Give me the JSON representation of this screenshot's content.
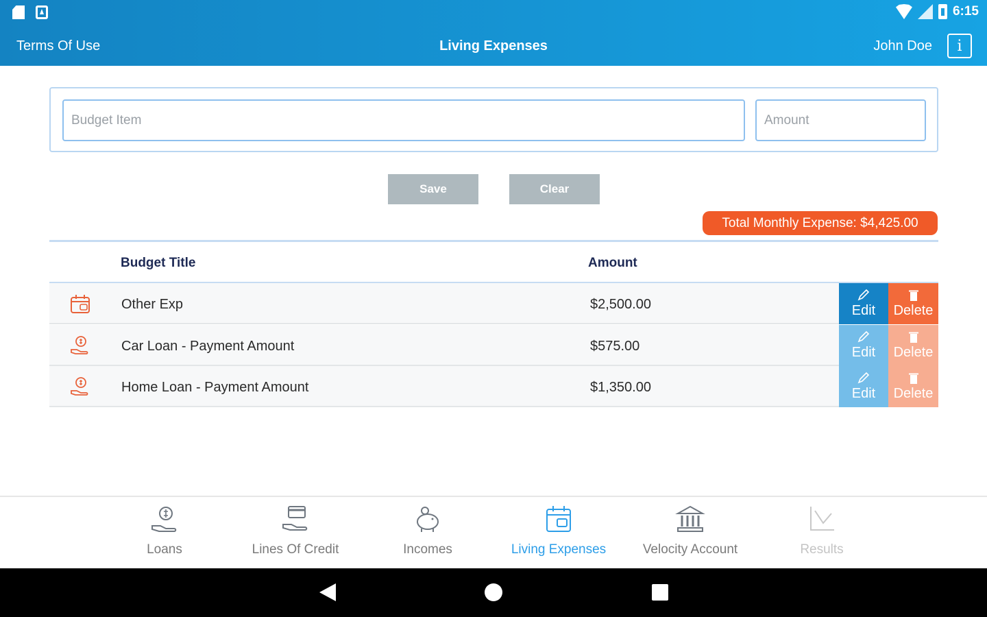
{
  "status_bar": {
    "time": "6:15"
  },
  "header": {
    "terms_label": "Terms Of Use",
    "title": "Living Expenses",
    "user_name": "John Doe",
    "info_label": "i"
  },
  "form": {
    "budget_item_placeholder": "Budget Item",
    "budget_item_value": "",
    "amount_placeholder": "Amount",
    "amount_value": "",
    "save_label": "Save",
    "clear_label": "Clear"
  },
  "total_badge": "Total Monthly Expense: $4,425.00",
  "table": {
    "headers": [
      "Budget Title",
      "Amount"
    ],
    "rows": [
      {
        "icon": "calendar-icon",
        "title": "Other Exp",
        "amount": "$2,500.00"
      },
      {
        "icon": "hand-coin-icon",
        "title": "Car Loan - Payment Amount",
        "amount": "$575.00"
      },
      {
        "icon": "hand-coin-icon",
        "title": "Home Loan - Payment Amount",
        "amount": "$1,350.00"
      }
    ],
    "edit_label": "Edit",
    "delete_label": "Delete"
  },
  "bottom_nav": {
    "items": [
      {
        "label": "Loans",
        "icon": "hand-coin-icon",
        "state": "normal"
      },
      {
        "label": "Lines Of Credit",
        "icon": "credit-card-hand-icon",
        "state": "normal"
      },
      {
        "label": "Incomes",
        "icon": "piggy-bank-icon",
        "state": "normal"
      },
      {
        "label": "Living Expenses",
        "icon": "calendar-icon",
        "state": "active"
      },
      {
        "label": "Velocity Account",
        "icon": "bank-icon",
        "state": "normal"
      },
      {
        "label": "Results",
        "icon": "chart-icon",
        "state": "disabled"
      }
    ]
  },
  "colors": {
    "header_start": "#1483c2",
    "header_end": "#17a3e3",
    "accent_orange": "#f05a28",
    "edit_blue": "#1683c6",
    "active_nav": "#2d9ee8",
    "button_gray": "#aeb9be"
  }
}
